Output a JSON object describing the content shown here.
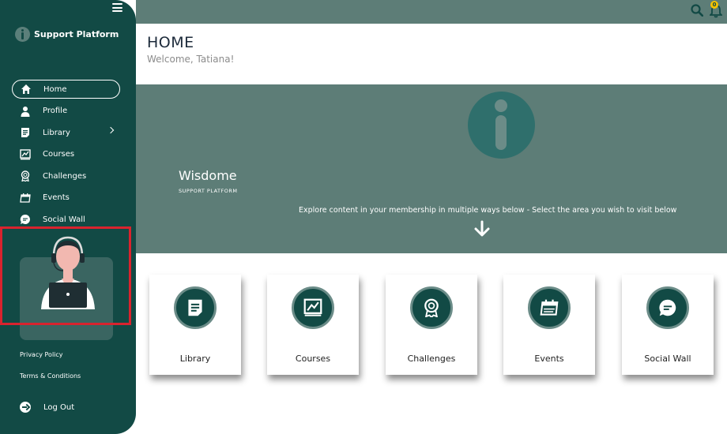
{
  "sidebar": {
    "brand": "Support Platform",
    "items": [
      {
        "label": "Home",
        "icon": "home-icon",
        "active": true
      },
      {
        "label": "Profile",
        "icon": "user-icon"
      },
      {
        "label": "Library",
        "icon": "document-icon",
        "has_submenu": true
      },
      {
        "label": "Courses",
        "icon": "chart-board-icon"
      },
      {
        "label": "Challenges",
        "icon": "award-icon"
      },
      {
        "label": "Events",
        "icon": "calendar-icon"
      },
      {
        "label": "Social Wall",
        "icon": "chat-icon"
      }
    ],
    "privacy": "Privacy Policy",
    "terms": "Terms & Conditions",
    "logout": "Log Out"
  },
  "topbar": {
    "notification_count": "0"
  },
  "header": {
    "title": "HOME",
    "welcome": "Welcome, Tatiana!"
  },
  "banner": {
    "title": "Wisdome",
    "subtitle": "SUPPORT PLATFORM",
    "explore": "Explore content in your membership in multiple ways below - Select the area you wish to visit below"
  },
  "cards": [
    {
      "label": "Library",
      "icon": "document-icon"
    },
    {
      "label": "Courses",
      "icon": "chart-board-icon"
    },
    {
      "label": "Challenges",
      "icon": "award-icon"
    },
    {
      "label": "Events",
      "icon": "calendar-icon"
    },
    {
      "label": "Social Wall",
      "icon": "chat-icon"
    }
  ],
  "colors": {
    "sidebar": "#124a45",
    "banner": "#5d7d77",
    "accent_ring": "#6b8c88",
    "highlight": "#d9232e",
    "badge": "#f5c200"
  }
}
